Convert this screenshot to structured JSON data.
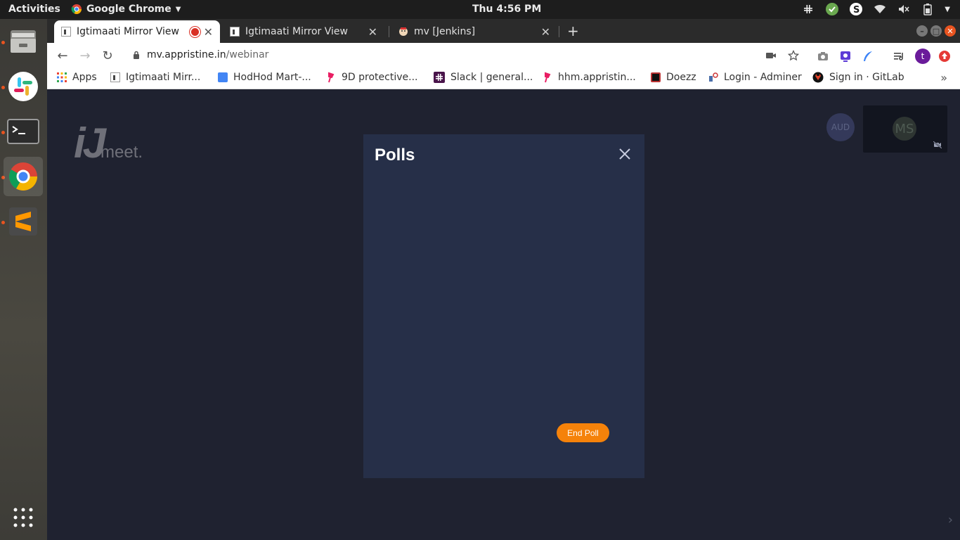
{
  "system": {
    "activities_label": "Activities",
    "app_menu_label": "Google Chrome",
    "clock": "Thu  4:56 PM"
  },
  "tabs": [
    {
      "title": "Igtimaati Mirror View",
      "active": true,
      "recording": true
    },
    {
      "title": "Igtimaati Mirror View",
      "active": false
    },
    {
      "title": "mv [Jenkins]",
      "active": false
    }
  ],
  "toolbar": {
    "url_host": "mv.appristine.in",
    "url_path": "/webinar"
  },
  "bookmarks": [
    {
      "label": "Apps",
      "icon": "apps-grid-icon"
    },
    {
      "label": "Igtimaati Mirr...",
      "icon": "ij-favicon"
    },
    {
      "label": "HodHod Mart-...",
      "icon": "docs-icon"
    },
    {
      "label": "9D protective...",
      "icon": "pin-icon"
    },
    {
      "label": "Slack | general...",
      "icon": "slack-icon"
    },
    {
      "label": "hhm.appristin...",
      "icon": "pin-icon"
    },
    {
      "label": "Doezz",
      "icon": "doezz-icon"
    },
    {
      "label": "Login - Adminer",
      "icon": "adminer-icon"
    },
    {
      "label": "Sign in · GitLab",
      "icon": "gitlab-icon"
    }
  ],
  "page": {
    "logo_text": "meet.",
    "audience_badge": "AUD",
    "self_avatar_initials": "MS",
    "poll": {
      "title": "Polls",
      "end_poll_label": "End Poll"
    }
  },
  "colors": {
    "page_bg": "#1f2230",
    "modal_bg": "#262f48",
    "accent_orange": "#f5820a"
  }
}
